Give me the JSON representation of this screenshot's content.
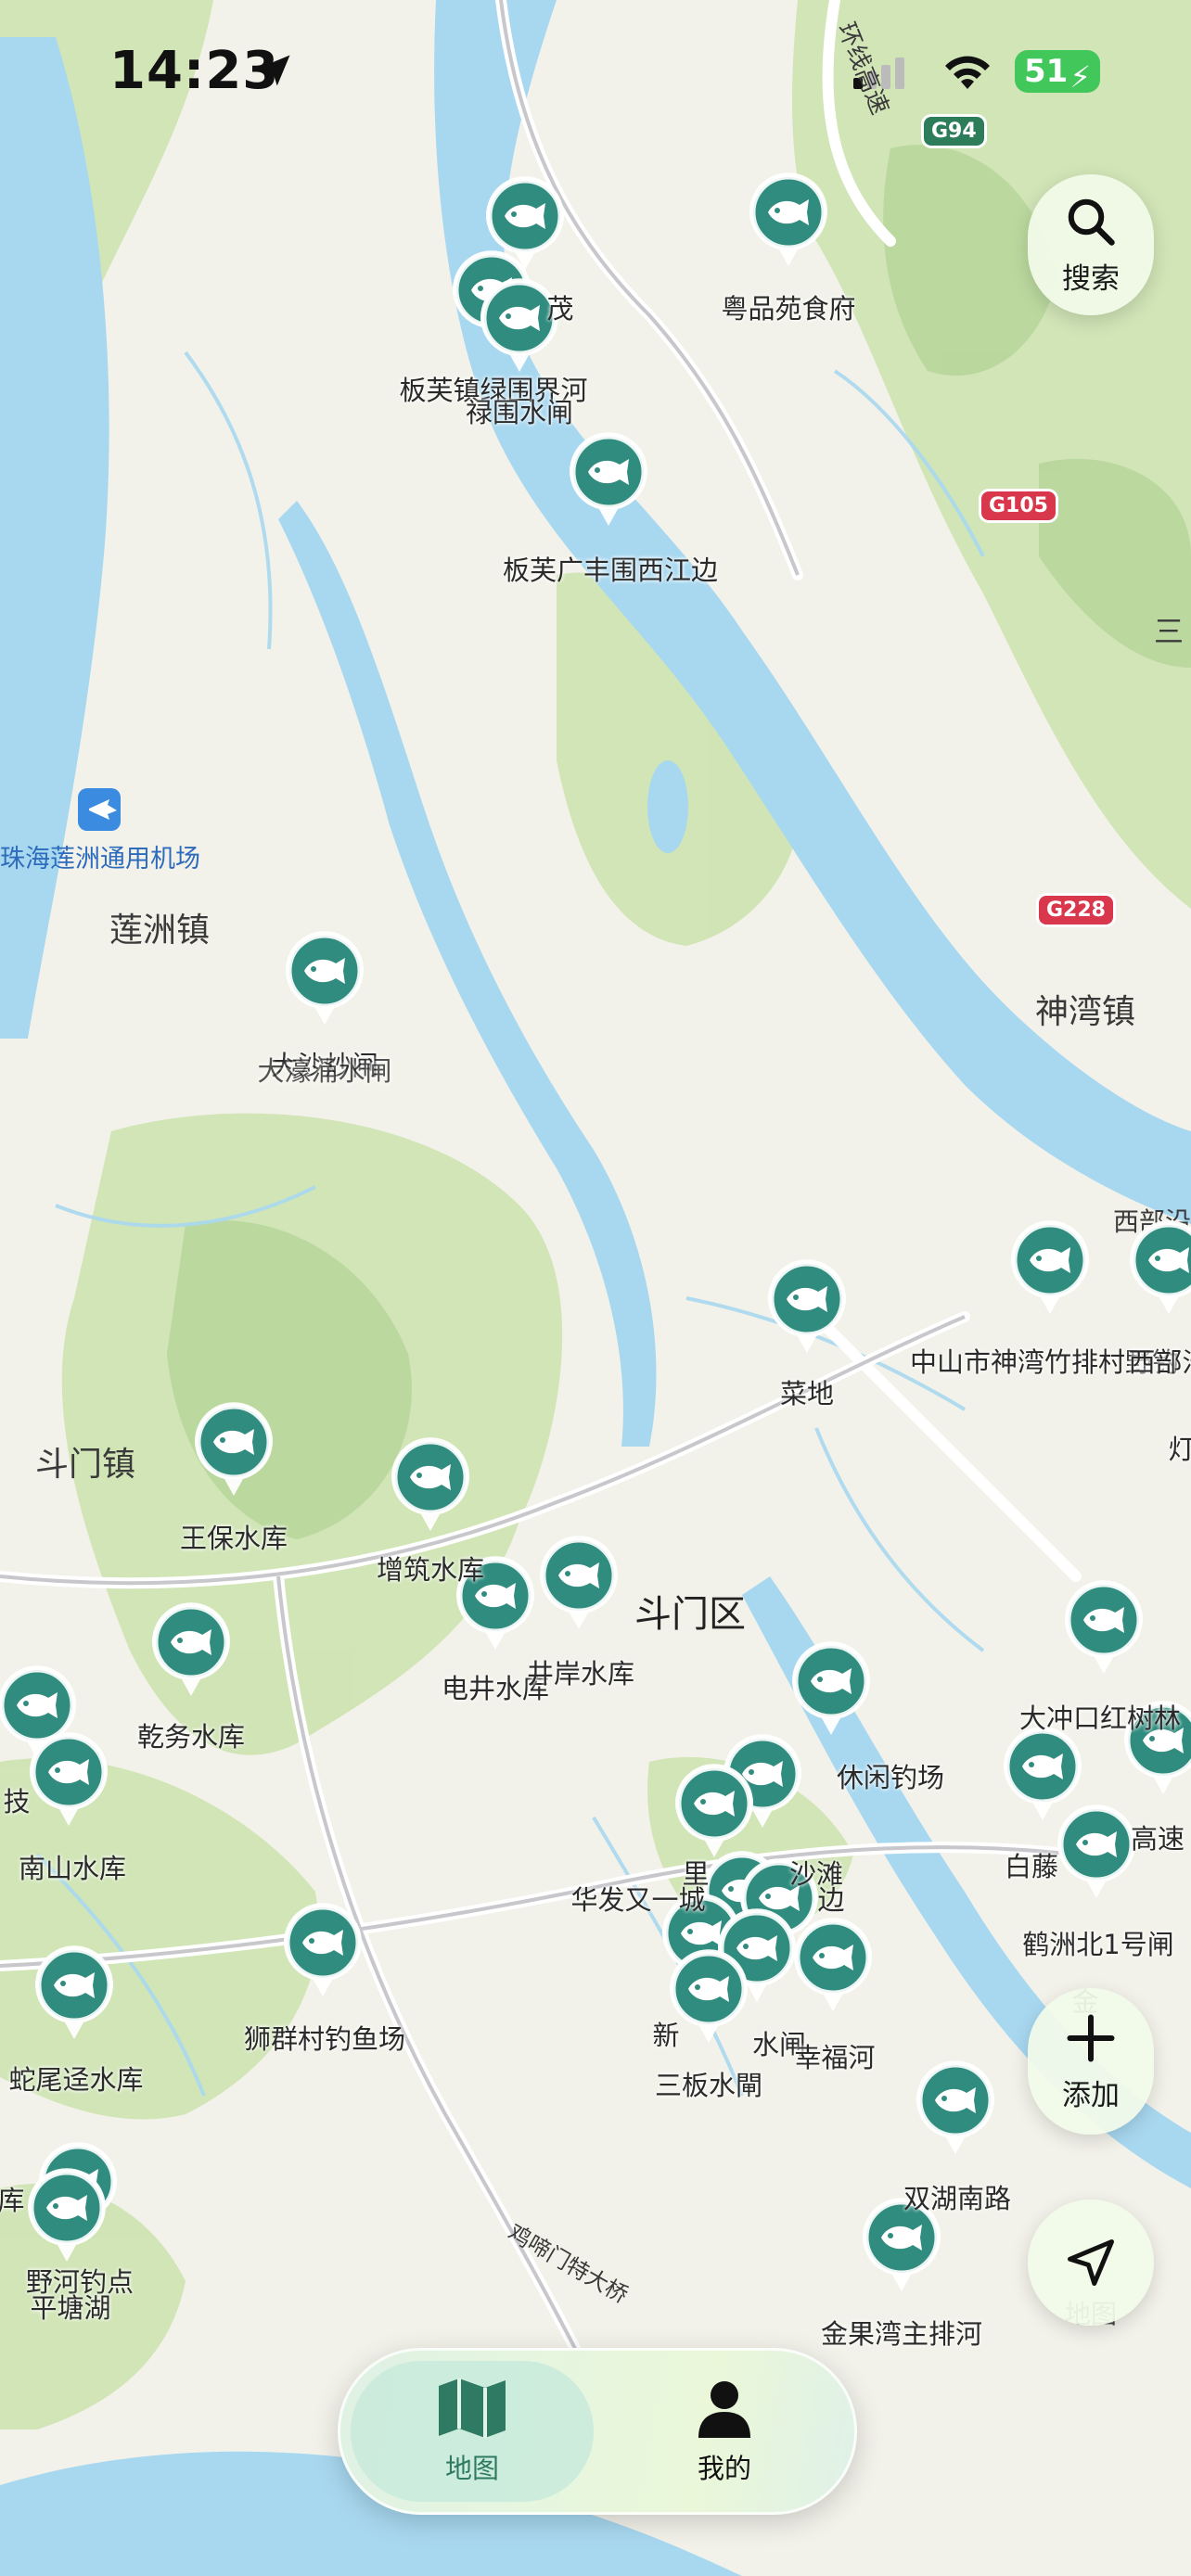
{
  "status_bar": {
    "time": "14:23",
    "battery": "51"
  },
  "map": {
    "place_labels": [
      {
        "text": "莲洲镇",
        "kind": "town"
      },
      {
        "text": "斗门镇",
        "kind": "town"
      },
      {
        "text": "神湾镇",
        "kind": "town"
      },
      {
        "text": "斗门区",
        "kind": "district"
      },
      {
        "text": "珠海莲洲通用机场",
        "kind": "airport"
      },
      {
        "text": "西部沿",
        "kind": "partial"
      },
      {
        "text": "三",
        "kind": "partial"
      },
      {
        "text": "环线高速",
        "kind": "road"
      },
      {
        "text": "鸡啼门特大桥",
        "kind": "road"
      }
    ],
    "road_shields": [
      "G94",
      "G105",
      "G228"
    ],
    "spots": [
      "茂",
      "粤品苑食府",
      "板芙镇绿围界河",
      "禄围水闸",
      "板芙广丰围西江边",
      "大沙炒闸",
      "大濠涌水闸",
      "菜地",
      "中山市神湾竹排村野钓",
      "西部沿",
      "王保水库",
      "增筑水库",
      "电井水库",
      "井岸水库",
      "乾务水库",
      "南山水库",
      "技",
      "狮群村钓鱼场",
      "蛇尾迳水库",
      "野河钓点",
      "平塘湖",
      "库",
      "休闲钓场",
      "里",
      "沙滩",
      "华发又一城",
      "边",
      "新",
      "水闸",
      "幸福河",
      "三板水閘",
      "大冲口红树林",
      "白藤",
      "高速",
      "鹤洲北1号闸",
      "双湖南路",
      "金果湾主排河",
      "灯",
      "金"
    ],
    "attribution": "地图"
  },
  "buttons": {
    "search": "搜索",
    "add": "添加"
  },
  "tabs": [
    {
      "label": "地图",
      "icon": "map-icon",
      "active": true
    },
    {
      "label": "我的",
      "icon": "person-icon",
      "active": false
    }
  ],
  "colors": {
    "marker_fill": "#2f8c7e",
    "accent": "#2f7a63",
    "land": "#f3f2ea",
    "green": "#cfe4b4",
    "water": "#a8d8f0"
  }
}
